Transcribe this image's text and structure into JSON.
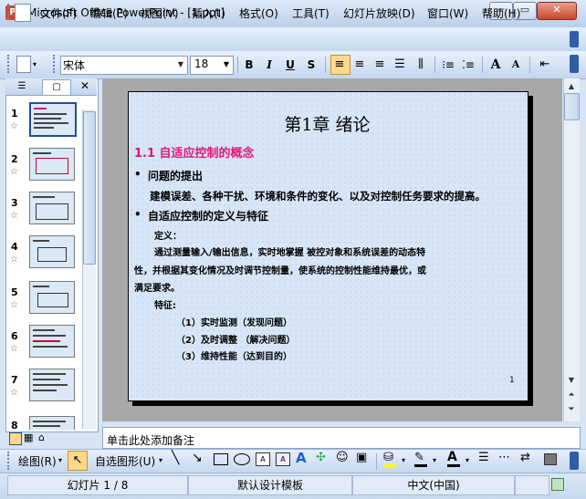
{
  "window": {
    "title": "Microsoft Office PowerPoint - [1.ppt]",
    "min": "─",
    "max": "▭",
    "close": "✕"
  },
  "menu": [
    "文件(F)",
    "编辑(E)",
    "视图(V)",
    "插入(I)",
    "格式(O)",
    "工具(T)",
    "幻灯片放映(D)",
    "窗口(W)",
    "帮助(H)"
  ],
  "toolbar": {
    "font": "宋体",
    "size": "18",
    "bold": "B",
    "italic": "I",
    "underline": "U",
    "shadow": "S",
    "grow": "A",
    "shrink": "A"
  },
  "pane": {
    "close": "✕",
    "slides": [
      {
        "num": "1"
      },
      {
        "num": "2"
      },
      {
        "num": "3"
      },
      {
        "num": "4"
      },
      {
        "num": "5"
      },
      {
        "num": "6"
      },
      {
        "num": "7"
      },
      {
        "num": "8"
      }
    ]
  },
  "slide": {
    "title": "第1章  绪论",
    "section": "1.1 自适应控制的概念",
    "bullet1": "问题的提出",
    "line1": "建模误差、各种干扰、环境和条件的变化、以及对控制任务要求的提高。",
    "bullet2": "自适应控制的定义与特征",
    "def_label": "定义：",
    "def_line1": "通过测量输入/输出信息，实时地掌握 被控对象和系统误差的动态特",
    "def_line2": "性，并根据其变化情况及时调节控制量，使系统的控制性能维持最优，或",
    "def_line3": "满足要求。",
    "feat_label": "特征:",
    "feat1": "（1）实时监测（发现问题）",
    "feat2": "（2）及时调整 （解决问题）",
    "feat3": "（3）维持性能（达到目的）",
    "page": "1"
  },
  "notes": {
    "placeholder": "单击此处添加备注"
  },
  "draw": {
    "draw_menu": "绘图(R)",
    "autoshape": "自选图形(U)"
  },
  "status": {
    "slide": "幻灯片 1 / 8",
    "template": "默认设计模板",
    "language": "中文(中国)"
  }
}
